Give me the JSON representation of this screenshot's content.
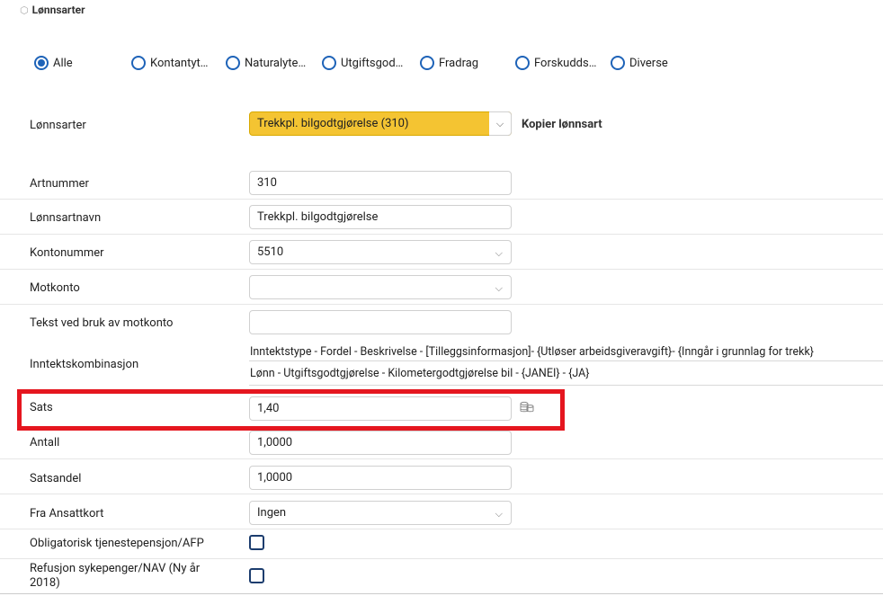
{
  "section": {
    "title": "Lønnsarter"
  },
  "filters": {
    "options": [
      "Alle",
      "Kontantyt…",
      "Naturalyte…",
      "Utgiftsgod…",
      "Fradrag",
      "Forskudds…",
      "Diverse"
    ],
    "selected": "Alle"
  },
  "lonnsarter": {
    "label": "Lønnsarter",
    "value": "Trekkpl. bilgodtgjørelse (310)",
    "copy_label": "Kopier lønnsart"
  },
  "form": {
    "artnummer": {
      "label": "Artnummer",
      "value": "310"
    },
    "lonnsartnavn": {
      "label": "Lønnsartnavn",
      "value": "Trekkpl. bilgodtgjørelse"
    },
    "kontonummer": {
      "label": "Kontonummer",
      "value": "5510"
    },
    "motkonto": {
      "label": "Motkonto",
      "value": ""
    },
    "tekst_motkonto": {
      "label": "Tekst ved bruk av motkonto",
      "value": ""
    },
    "inntektskombinasjon": {
      "label": "Inntektskombinasjon",
      "header": "Inntektstype - Fordel - Beskrivelse - [Tilleggsinformasjon]- {Utløser arbeidsgiveravgift}- {Inngår i grunnlag for trekk}",
      "value": "Lønn - Utgiftsgodtgjørelse - Kilometergodtgjørelse bil - {JANEI} - {JA}"
    },
    "sats": {
      "label": "Sats",
      "value": "1,40"
    },
    "antall": {
      "label": "Antall",
      "value": "1,0000"
    },
    "satsandel": {
      "label": "Satsandel",
      "value": "1,0000"
    },
    "fra_ansattkort": {
      "label": "Fra Ansattkort",
      "value": "Ingen"
    },
    "otp": {
      "label": "Obligatorisk tjenestepensjon/AFP",
      "checked": false
    },
    "refusjon": {
      "label": "Refusjon sykepenger/NAV (Ny år 2018)",
      "checked": false
    }
  },
  "colors": {
    "accent": "#1e63b8",
    "highlight": "#e5161f",
    "selected_field": "#f4c432"
  }
}
